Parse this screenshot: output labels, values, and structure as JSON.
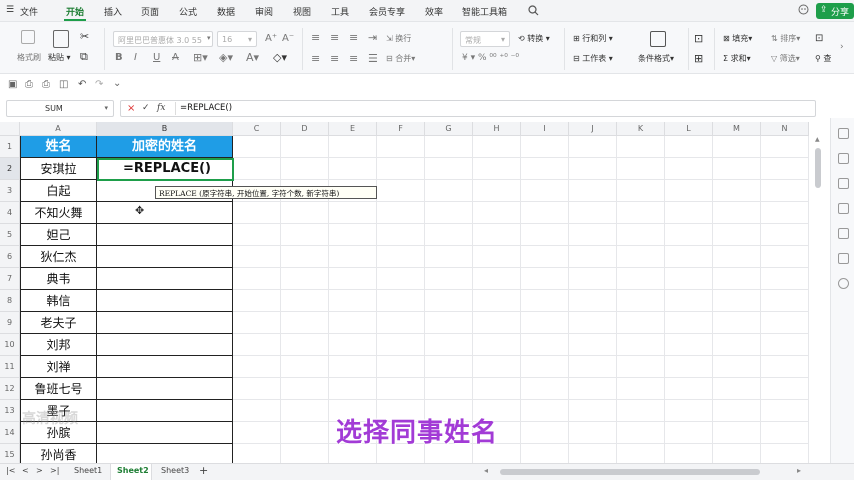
{
  "menubar": {
    "file": "文件",
    "tabs": [
      "开始",
      "插入",
      "页面",
      "公式",
      "数据",
      "审阅",
      "视图",
      "工具",
      "会员专享",
      "效率",
      "智能工具箱"
    ],
    "active_tab": "开始",
    "share": "分享"
  },
  "ribbon": {
    "format_painter": "格式刷",
    "paste": "粘贴",
    "font_name": "阿里巴巴普惠体 3.0 55",
    "font_size": "16",
    "wrap": "换行",
    "merge": "合并",
    "number_format": "常规",
    "convert": "转换",
    "row_col": "行和列",
    "worksheet": "工作表",
    "cond_format": "条件格式",
    "fill": "填充",
    "sort": "排序",
    "sum": "求和",
    "filter": "筛选",
    "find": "查"
  },
  "formula_bar": {
    "name_box": "SUM",
    "cancel": "×",
    "confirm": "✓",
    "fx": "fx",
    "formula": "=REPLACE()"
  },
  "columns": [
    "A",
    "B",
    "C",
    "D",
    "E",
    "F",
    "G",
    "H",
    "I",
    "J",
    "K",
    "L",
    "M",
    "N"
  ],
  "rows": [
    "1",
    "2",
    "3",
    "4",
    "5",
    "6",
    "7",
    "8",
    "9",
    "10",
    "11",
    "12",
    "13",
    "14",
    "15"
  ],
  "table": {
    "header_a": "姓名",
    "header_b": "加密的姓名",
    "names": [
      "安琪拉",
      "白起",
      "不知火舞",
      "妲己",
      "狄仁杰",
      "典韦",
      "韩信",
      "老夫子",
      "刘邦",
      "刘禅",
      "鲁班七号",
      "墨子",
      "孙膑",
      "孙尚香"
    ],
    "editing_value": "=REPLACE()"
  },
  "tooltip": "REPLACE (原字符串, 开始位置, 字符个数, 新字符串)",
  "sheets": [
    "Sheet1",
    "Sheet2",
    "Sheet3"
  ],
  "active_sheet": "Sheet2",
  "subtitle": "选择同事姓名",
  "watermark": "高清视频",
  "colors": {
    "header_fill": "#1f9de6",
    "accent_green": "#1e9e4a",
    "subtitle": "#a23bd6"
  }
}
